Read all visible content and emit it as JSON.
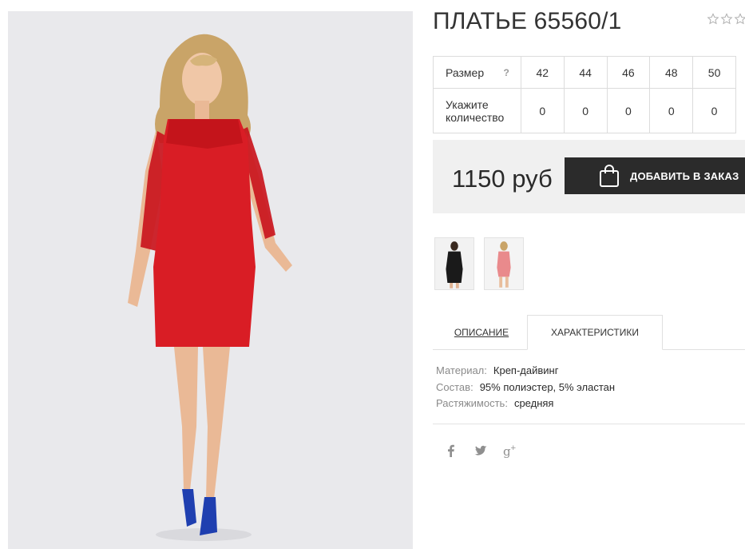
{
  "product": {
    "title": "ПЛАТЬЕ 65560/1",
    "rating": {
      "value": 0,
      "max": 5
    }
  },
  "size_table": {
    "size_label": "Размер",
    "help": "?",
    "qty_label": "Укажите количество",
    "sizes": [
      "42",
      "44",
      "46",
      "48",
      "50"
    ],
    "quantities": [
      "0",
      "0",
      "0",
      "0",
      "0"
    ]
  },
  "price": "1150 руб",
  "buy_button": {
    "label": "ДОБАВИТЬ В ЗАКАЗ",
    "icon": "shopping-bag-icon"
  },
  "thumbnails": [
    {
      "name": "thumbnail-black-dress",
      "color": "#1a1a1a"
    },
    {
      "name": "thumbnail-pink-dress",
      "color": "#e98a8c"
    }
  ],
  "tabs": [
    {
      "label": "ОПИСАНИЕ",
      "active": false
    },
    {
      "label": "ХАРАКТЕРИСТИКИ",
      "active": true
    }
  ],
  "specs": [
    {
      "key": "Материал:",
      "value": "Креп-дайвинг"
    },
    {
      "key": "Состав:",
      "value": "95% полиэстер, 5% эластан"
    },
    {
      "key": "Растяжимость:",
      "value": "средняя"
    }
  ],
  "social": [
    "facebook-icon",
    "twitter-icon",
    "google-plus-icon"
  ],
  "colors": {
    "dress": "#d91d25",
    "button": "#2b2b2b",
    "price_bg": "#f0f0f0",
    "photo_bg": "#e9e9ec",
    "shoes": "#1f3fb0"
  }
}
